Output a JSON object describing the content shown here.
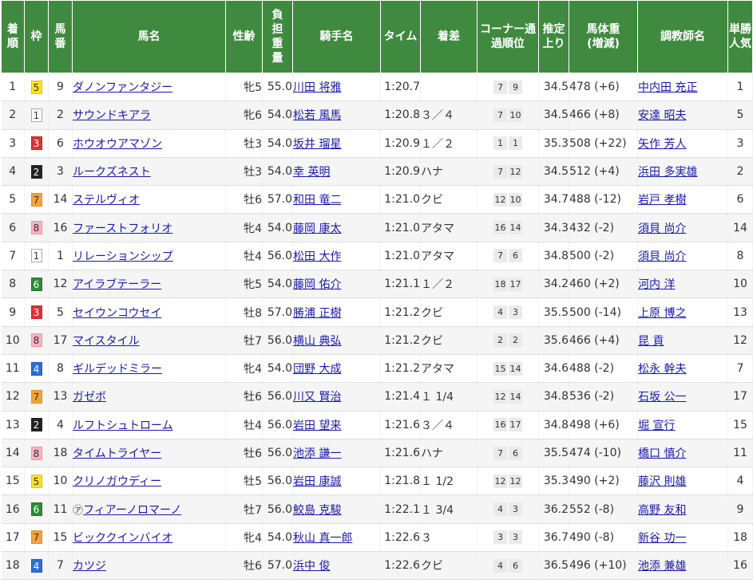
{
  "headers": {
    "rank": "着順",
    "gate": "枠",
    "num": "馬番",
    "horse": "馬名",
    "sexage": "性齢",
    "weight": "負担重量",
    "jockey": "騎手名",
    "time": "タイム",
    "margin": "着差",
    "corner": "コーナー通過順位",
    "last3f": "推定上り",
    "bodyweight": "馬体重(増減)",
    "trainer": "調教師名",
    "pop": "単勝人気"
  },
  "gate_colors": {
    "1": "#ffffff",
    "2": "#222222",
    "3": "#d8333a",
    "4": "#2c6fd6",
    "5": "#f7e322",
    "6": "#2f8a3a",
    "7": "#f4a33a",
    "8": "#f6b2c3"
  },
  "rows": [
    {
      "rank": "1",
      "gate": "5",
      "num": "9",
      "horse": "ダノンファンタジー",
      "mark": "",
      "sexage": "牝5",
      "weight": "55.0",
      "jockey": "川田 将雅",
      "time": "1:20.7",
      "margin": "",
      "c1": "7",
      "c2": "9",
      "last3f": "34.5",
      "body": "478 (+6)",
      "trainer": "中内田 充正",
      "pop": "1"
    },
    {
      "rank": "2",
      "gate": "1",
      "num": "2",
      "horse": "サウンドキアラ",
      "mark": "",
      "sexage": "牝6",
      "weight": "54.0",
      "jockey": "松若 風馬",
      "time": "1:20.8",
      "margin": "３／４",
      "c1": "7",
      "c2": "10",
      "last3f": "34.5",
      "body": "466 (+8)",
      "trainer": "安達 昭夫",
      "pop": "5"
    },
    {
      "rank": "3",
      "gate": "3",
      "num": "6",
      "horse": "ホウオウアマゾン",
      "mark": "",
      "sexage": "牡3",
      "weight": "54.0",
      "jockey": "坂井 瑠星",
      "time": "1:20.9",
      "margin": "１／２",
      "c1": "1",
      "c2": "1",
      "last3f": "35.3",
      "body": "508 (+22)",
      "trainer": "矢作 芳人",
      "pop": "3"
    },
    {
      "rank": "4",
      "gate": "2",
      "num": "3",
      "horse": "ルークズネスト",
      "mark": "",
      "sexage": "牡3",
      "weight": "54.0",
      "jockey": "幸 英明",
      "time": "1:20.9",
      "margin": "ハナ",
      "c1": "7",
      "c2": "12",
      "last3f": "34.5",
      "body": "512 (+4)",
      "trainer": "浜田 多実雄",
      "pop": "2"
    },
    {
      "rank": "5",
      "gate": "7",
      "num": "14",
      "horse": "ステルヴィオ",
      "mark": "",
      "sexage": "牡6",
      "weight": "57.0",
      "jockey": "和田 竜二",
      "time": "1:21.0",
      "margin": "クビ",
      "c1": "12",
      "c2": "10",
      "last3f": "34.7",
      "body": "488 (-12)",
      "trainer": "岩戸 孝樹",
      "pop": "6"
    },
    {
      "rank": "6",
      "gate": "8",
      "num": "16",
      "horse": "ファーストフォリオ",
      "mark": "",
      "sexage": "牝4",
      "weight": "54.0",
      "jockey": "藤岡 康太",
      "time": "1:21.0",
      "margin": "アタマ",
      "c1": "16",
      "c2": "14",
      "last3f": "34.3",
      "body": "432 (-2)",
      "trainer": "須貝 尚介",
      "pop": "14"
    },
    {
      "rank": "7",
      "gate": "1",
      "num": "1",
      "horse": "リレーションシップ",
      "mark": "",
      "sexage": "牡4",
      "weight": "56.0",
      "jockey": "松田 大作",
      "time": "1:21.0",
      "margin": "アタマ",
      "c1": "7",
      "c2": "6",
      "last3f": "34.8",
      "body": "500 (-2)",
      "trainer": "須貝 尚介",
      "pop": "8"
    },
    {
      "rank": "8",
      "gate": "6",
      "num": "12",
      "horse": "アイラブテーラー",
      "mark": "",
      "sexage": "牝5",
      "weight": "54.0",
      "jockey": "藤岡 佑介",
      "time": "1:21.1",
      "margin": "１／２",
      "c1": "18",
      "c2": "17",
      "last3f": "34.2",
      "body": "460 (+2)",
      "trainer": "河内 洋",
      "pop": "10"
    },
    {
      "rank": "9",
      "gate": "3",
      "num": "5",
      "horse": "セイウンコウセイ",
      "mark": "",
      "sexage": "牡8",
      "weight": "57.0",
      "jockey": "勝浦 正樹",
      "time": "1:21.2",
      "margin": "クビ",
      "c1": "4",
      "c2": "3",
      "last3f": "35.5",
      "body": "500 (-14)",
      "trainer": "上原 博之",
      "pop": "13"
    },
    {
      "rank": "10",
      "gate": "8",
      "num": "17",
      "horse": "マイスタイル",
      "mark": "",
      "sexage": "牡7",
      "weight": "56.0",
      "jockey": "横山 典弘",
      "time": "1:21.2",
      "margin": "クビ",
      "c1": "2",
      "c2": "2",
      "last3f": "35.6",
      "body": "466 (+4)",
      "trainer": "昆 貢",
      "pop": "12"
    },
    {
      "rank": "11",
      "gate": "4",
      "num": "8",
      "horse": "ギルデッドミラー",
      "mark": "",
      "sexage": "牝4",
      "weight": "54.0",
      "jockey": "団野 大成",
      "time": "1:21.2",
      "margin": "アタマ",
      "c1": "15",
      "c2": "14",
      "last3f": "34.6",
      "body": "488 (-2)",
      "trainer": "松永 幹夫",
      "pop": "7"
    },
    {
      "rank": "12",
      "gate": "7",
      "num": "13",
      "horse": "ガゼボ",
      "mark": "",
      "sexage": "牡6",
      "weight": "56.0",
      "jockey": "川又 賢治",
      "time": "1:21.4",
      "margin": "１ 1/4",
      "c1": "12",
      "c2": "14",
      "last3f": "34.8",
      "body": "536 (-2)",
      "trainer": "石坂 公一",
      "pop": "17"
    },
    {
      "rank": "13",
      "gate": "2",
      "num": "4",
      "horse": "ルフトシュトローム",
      "mark": "",
      "sexage": "牡4",
      "weight": "56.0",
      "jockey": "岩田 望来",
      "time": "1:21.6",
      "margin": "３／４",
      "c1": "16",
      "c2": "17",
      "last3f": "34.8",
      "body": "498 (+6)",
      "trainer": "堀 宣行",
      "pop": "15"
    },
    {
      "rank": "14",
      "gate": "8",
      "num": "18",
      "horse": "タイムトライヤー",
      "mark": "",
      "sexage": "牡6",
      "weight": "56.0",
      "jockey": "池添 謙一",
      "time": "1:21.6",
      "margin": "ハナ",
      "c1": "7",
      "c2": "6",
      "last3f": "35.5",
      "body": "474 (-10)",
      "trainer": "橋口 慎介",
      "pop": "11"
    },
    {
      "rank": "15",
      "gate": "5",
      "num": "10",
      "horse": "クリノガウディー",
      "mark": "",
      "sexage": "牡5",
      "weight": "56.0",
      "jockey": "岩田 康誠",
      "time": "1:21.8",
      "margin": "１ 1/2",
      "c1": "12",
      "c2": "12",
      "last3f": "35.3",
      "body": "490 (+2)",
      "trainer": "藤沢 則雄",
      "pop": "4"
    },
    {
      "rank": "16",
      "gate": "6",
      "num": "11",
      "horse": "フィアーノロマーノ",
      "mark": "㋐",
      "sexage": "牡7",
      "weight": "56.0",
      "jockey": "鮫島 克駿",
      "time": "1:22.1",
      "margin": "１ 3/4",
      "c1": "4",
      "c2": "3",
      "last3f": "36.2",
      "body": "552 (-8)",
      "trainer": "高野 友和",
      "pop": "9"
    },
    {
      "rank": "17",
      "gate": "7",
      "num": "15",
      "horse": "ビッククインバイオ",
      "mark": "",
      "sexage": "牝4",
      "weight": "54.0",
      "jockey": "秋山 真一郎",
      "time": "1:22.6",
      "margin": "３",
      "c1": "3",
      "c2": "3",
      "last3f": "36.7",
      "body": "490 (-8)",
      "trainer": "新谷 功一",
      "pop": "18"
    },
    {
      "rank": "18",
      "gate": "4",
      "num": "7",
      "horse": "カツジ",
      "mark": "",
      "sexage": "牡6",
      "weight": "57.0",
      "jockey": "浜中 俊",
      "time": "1:22.6",
      "margin": "クビ",
      "c1": "4",
      "c2": "6",
      "last3f": "36.5",
      "body": "496 (+10)",
      "trainer": "池添 兼雄",
      "pop": "16"
    }
  ]
}
